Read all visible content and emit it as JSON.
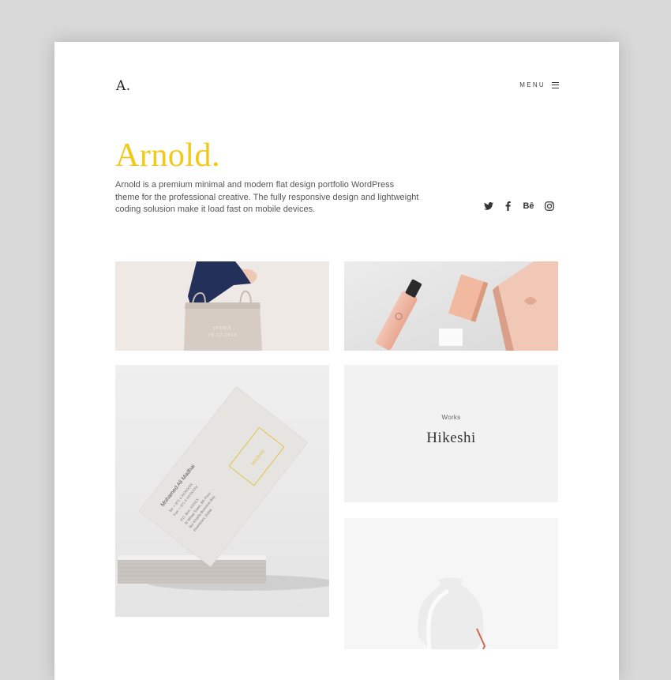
{
  "header": {
    "logo": "A.",
    "menu_label": "MENU"
  },
  "hero": {
    "title": "Arnold.",
    "description": "Arnold is a premium minimal and modern flat design portfolio WordPress theme for the professional creative. The fully responsive design and lightweight coding solusion make it load fast on mobile devices."
  },
  "social": [
    {
      "icon": "twitter-icon"
    },
    {
      "icon": "facebook-icon"
    },
    {
      "icon": "behance-icon",
      "glyph": "Bē"
    },
    {
      "icon": "instagram-icon"
    }
  ],
  "colors": {
    "accent": "#f2c91a",
    "page_bg": "#ffffff",
    "outer_bg": "#d9d9d9"
  },
  "tiles": {
    "tote_bag": {
      "print": "INDEX\n19.12.2018"
    },
    "business_card": {
      "name": "Mohamed Ali Madhai",
      "lines": [
        "Tel: + 971 4 XXXXXXX",
        "Fax: + 971 4 XXXXXXX",
        "P.O. Box: XXXXX",
        "Al Ittihad Tower, 8th Floor",
        "Bur Khalifa Business Bay",
        "Downtown, Dubai"
      ]
    },
    "works": {
      "label": "Works",
      "title": "Hikeshi"
    }
  }
}
